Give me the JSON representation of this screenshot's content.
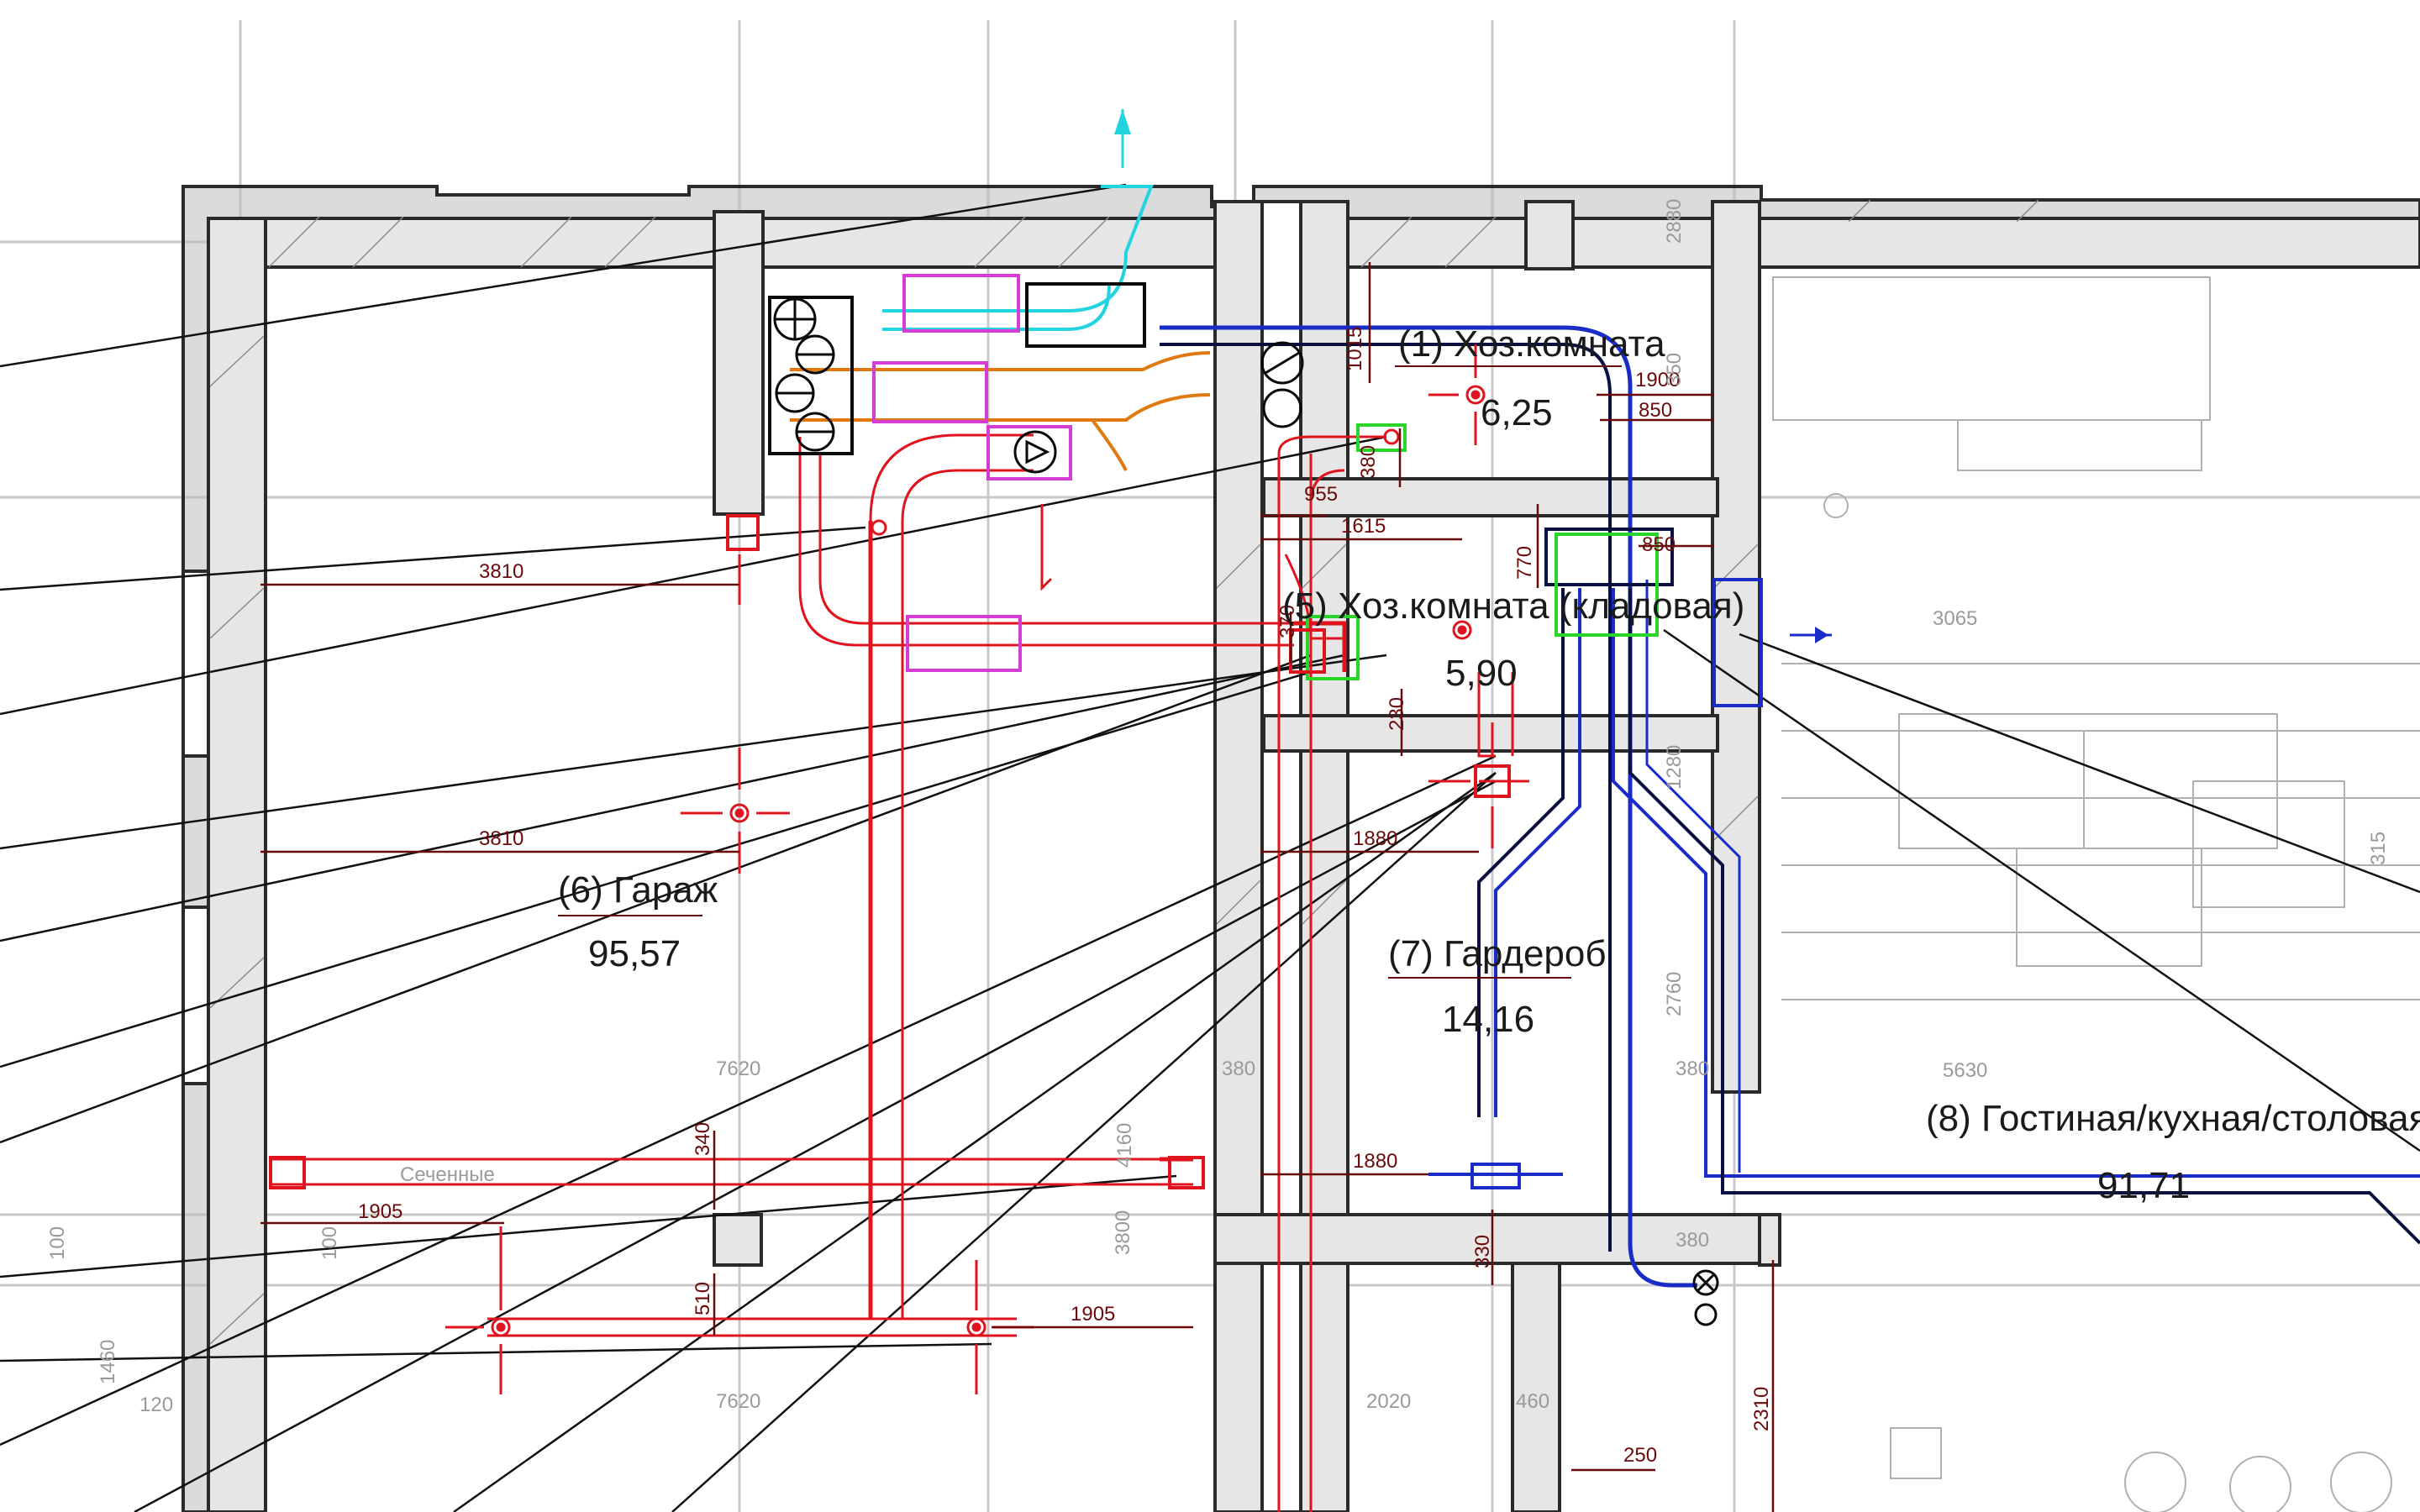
{
  "colors": {
    "background": "#ffffff",
    "grid": "#c8c8c8",
    "wall": "#2a2a2a",
    "wall_fill": "#bdbdbd",
    "supply_duct": "#e0141e",
    "exhaust_duct": "#1a2cc8",
    "duct_dark": "#0a1040",
    "fresh_air": "#22d3e0",
    "orange_duct": "#e07a10",
    "equipment_magenta": "#d43cd4",
    "equipment_green": "#2ad52a",
    "dimension": "#6a0a0a",
    "ghost_text": "#9a9a9a",
    "leader": "#111111"
  },
  "icons": [
    "fan-icon",
    "valve-icon",
    "diffuser-icon",
    "damper-icon",
    "air-terminal-icon"
  ],
  "rooms": [
    {
      "id": "khoz1",
      "name": "(1) Хоз.комната",
      "area": "6,25"
    },
    {
      "id": "khoz5",
      "name": "(5) Хоз.комната (кладовая)",
      "area": "5,90"
    },
    {
      "id": "garage",
      "name": "(6) Гараж",
      "area": "95,57"
    },
    {
      "id": "wardrobe",
      "name": "(7) Гардероб",
      "area": "14,16"
    },
    {
      "id": "living",
      "name": "(8) Гостиная/кухная/столовая",
      "area": "91,71"
    }
  ],
  "dimensions": {
    "d3810a": "3810",
    "d3810b": "3810",
    "d1905a": "1905",
    "d1905b": "1905",
    "d1015": "1015",
    "d1900": "1900",
    "d850a": "850",
    "d850b": "850",
    "d955": "955",
    "d1615": "1615",
    "d380a": "380",
    "d770": "770",
    "d230": "230",
    "d1880a": "1880",
    "d1880b": "1880",
    "d340": "340",
    "d510": "510",
    "d330": "330",
    "d250": "250",
    "d2310": "2310",
    "d370": "370"
  },
  "ghost_labels": {
    "g7620a": "7620",
    "g7620b": "7620",
    "g4160": "4160",
    "g380a": "380",
    "g380b": "380",
    "g380c": "380",
    "g5630": "5630",
    "g3065": "3065",
    "g2020": "2020",
    "g1460": "1460",
    "g120": "120",
    "g3800": "3800",
    "g460": "460",
    "g315": "315",
    "g2760": "2760",
    "g1280": "1280",
    "g2880": "2880",
    "g350": "350",
    "g100a": "100",
    "g100b": "100",
    "sechenie": "Сеченные"
  }
}
